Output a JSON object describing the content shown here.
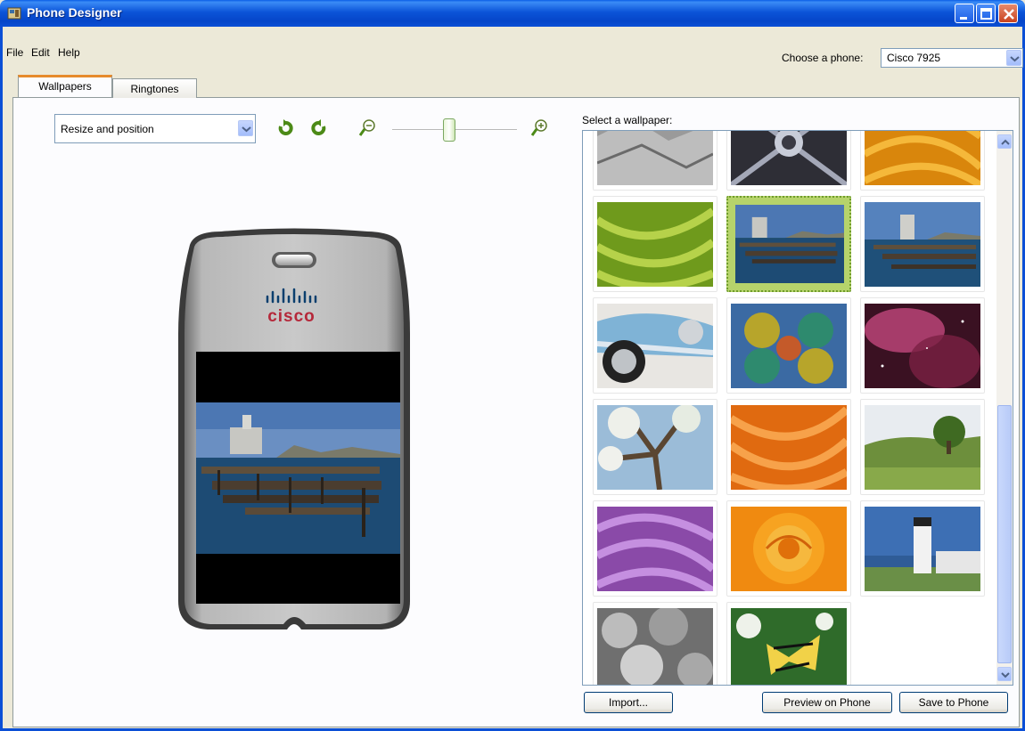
{
  "window": {
    "title": "Phone Designer"
  },
  "menu": {
    "file": "File",
    "edit": "Edit",
    "help": "Help"
  },
  "phone_chooser": {
    "label": "Choose a phone:",
    "value": "Cisco 7925"
  },
  "tabs": [
    {
      "label": "Wallpapers"
    },
    {
      "label": "Ringtones"
    }
  ],
  "editor": {
    "mode": "Resize and position",
    "zoom_level": 0.46
  },
  "phone": {
    "brand": "cisco"
  },
  "gallery": {
    "label": "Select a wallpaper:",
    "selected_index": 4,
    "thumbnails": [
      "gray-tiles",
      "kaleidoscope-dark",
      "orange-swirl",
      "green-swirl",
      "pier-sea-lions",
      "pier-sea-lions-2",
      "blue-classic-car",
      "kaleidoscope-color",
      "pink-nebula",
      "blossom-tree",
      "orange-swirl-2",
      "green-landscape",
      "purple-swirl",
      "orange-rose",
      "lighthouse",
      "succulents-bw",
      "swallowtail-butterfly"
    ]
  },
  "buttons": {
    "import": "Import...",
    "preview": "Preview on Phone",
    "save": "Save to Phone"
  },
  "colors": {
    "titlebar": "#0b54d8",
    "tab_accent": "#e68b2c",
    "selection": "#b6d36b"
  }
}
